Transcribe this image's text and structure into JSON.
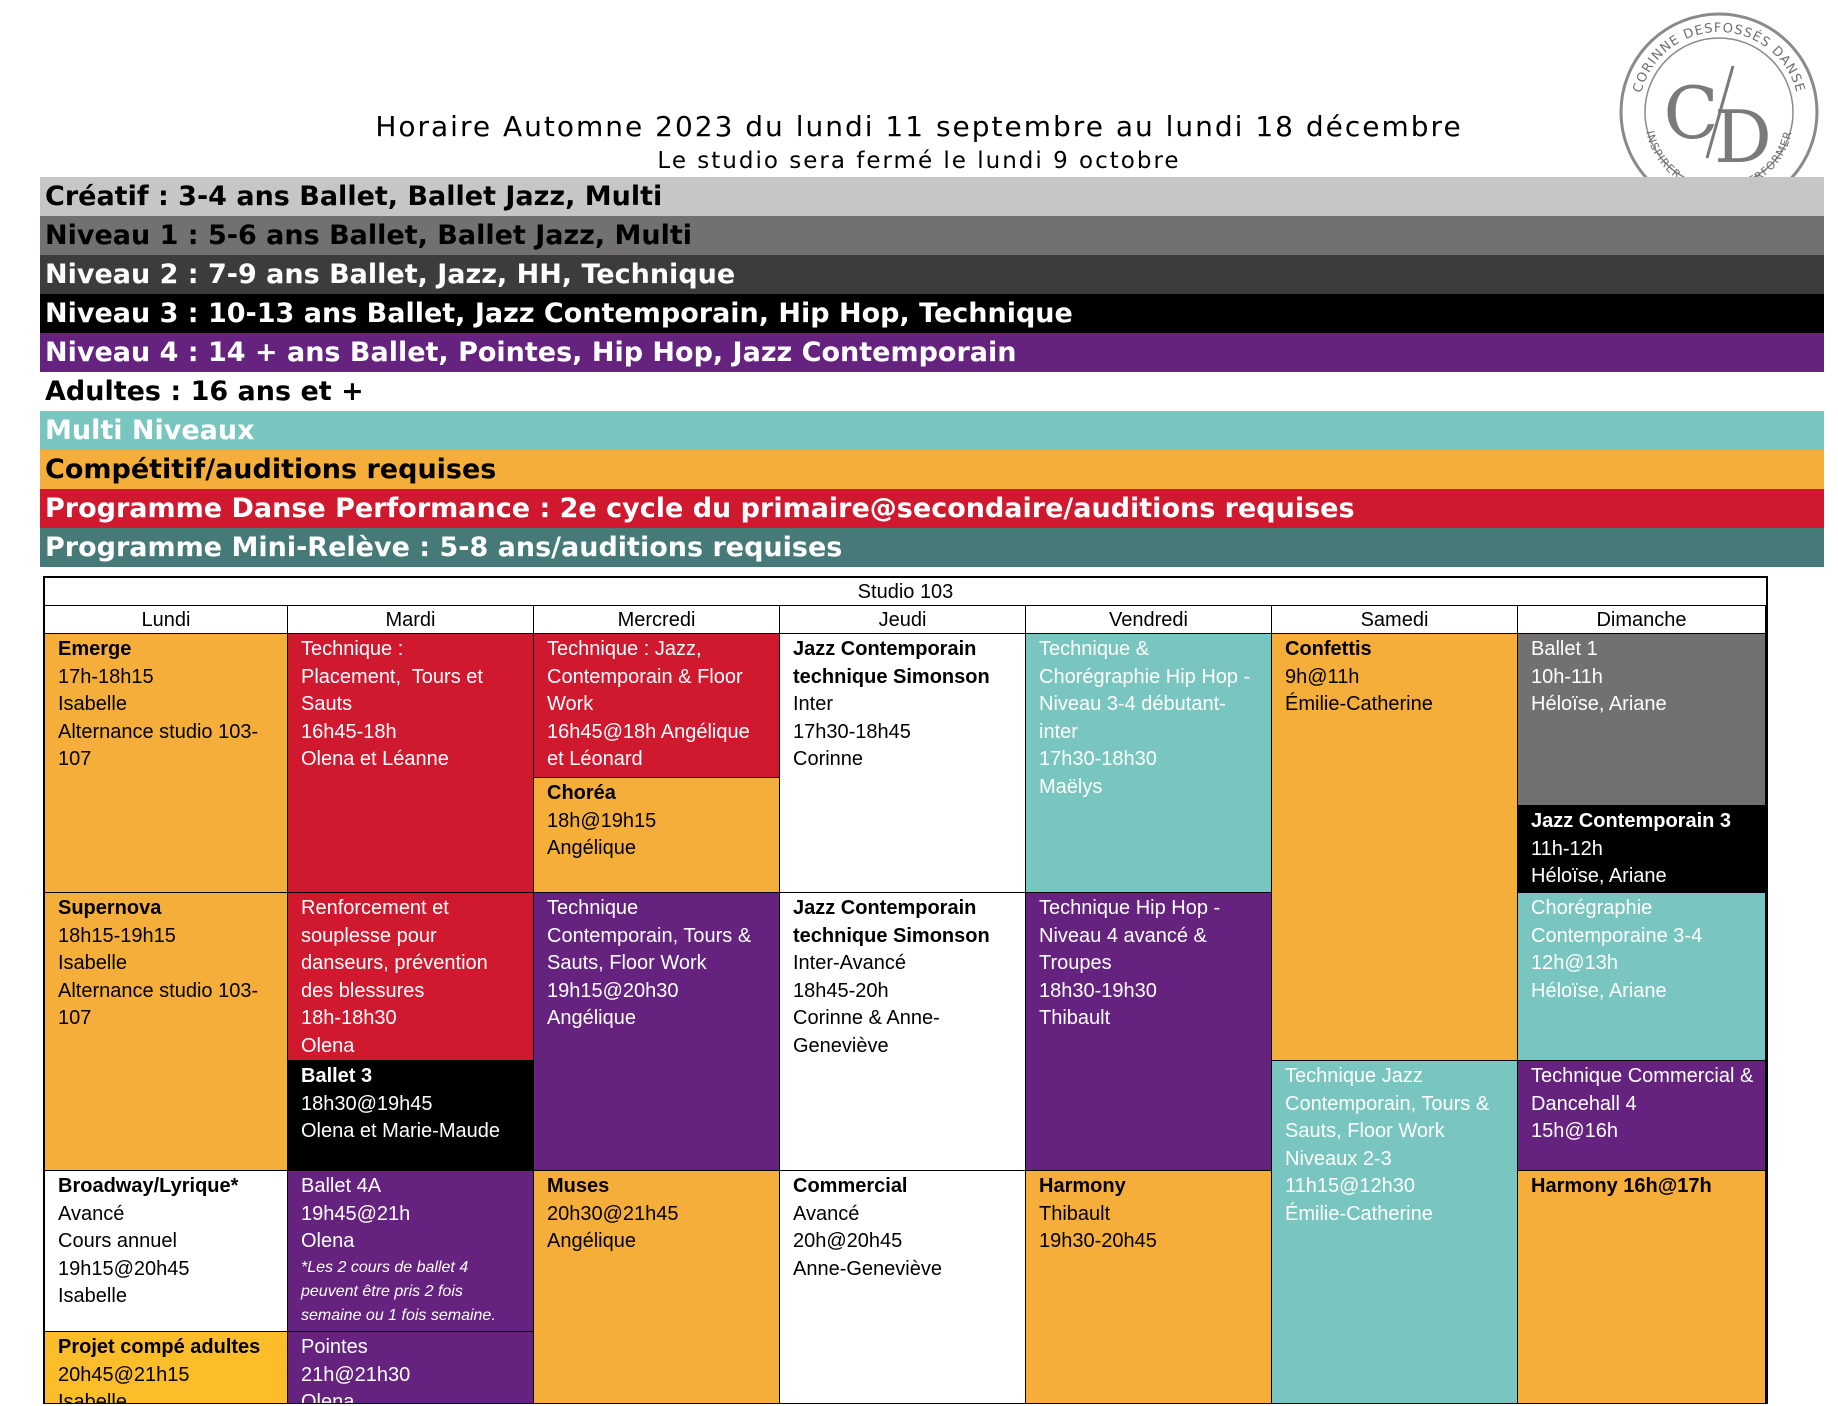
{
  "header": {
    "title": "Horaire Automne 2023 du lundi 11 septembre au lundi 18 décembre",
    "subtitle": "Le studio sera fermé le lundi 9 octobre"
  },
  "logo": {
    "monogram": "C/D",
    "ring_top": "CORINNE DESFOSSÉS DANSE",
    "ring_bottom": "INSPIRER · CRÉER · PERFORMER"
  },
  "legend": [
    {
      "label": "Créatif : 3-4 ans Ballet, Ballet Jazz, Multi",
      "bg": "#c6c6c6",
      "fg": "#000000"
    },
    {
      "label": "Niveau 1 : 5-6 ans Ballet, Ballet Jazz, Multi",
      "bg": "#727070",
      "fg": "#000000"
    },
    {
      "label": "Niveau 2 : 7-9 ans Ballet, Jazz, HH, Technique",
      "bg": "#3c3c3c",
      "fg": "#ffffff"
    },
    {
      "label": "Niveau 3 : 10-13 ans Ballet, Jazz Contemporain, Hip Hop, Technique",
      "bg": "#000000",
      "fg": "#ffffff"
    },
    {
      "label": "Niveau 4 : 14 + ans Ballet, Pointes, Hip Hop, Jazz Contemporain",
      "bg": "#65237f",
      "fg": "#ffffff"
    },
    {
      "label": "Adultes : 16 ans et +",
      "bg": "#ffffff",
      "fg": "#000000"
    },
    {
      "label": "Multi Niveaux",
      "bg": "#78c6bf",
      "fg": "#ffffff"
    },
    {
      "label": "Compétitif/auditions requises",
      "bg": "#f6ae3a",
      "fg": "#000000"
    },
    {
      "label": "Programme Danse Performance : 2e cycle du primaire@secondaire/auditions requises",
      "bg": "#d0182f",
      "fg": "#ffffff"
    },
    {
      "label": "Programme Mini-Relève : 5-8 ans/auditions requises",
      "bg": "#467a78",
      "fg": "#ffffff"
    }
  ],
  "schedule": {
    "studio": "Studio 103",
    "days": [
      "Lundi",
      "Mardi",
      "Mercredi",
      "Jeudi",
      "Vendredi",
      "Samedi",
      "Dimanche"
    ],
    "classes": {
      "lundi": [
        {
          "lines": [
            "Emerge",
            "17h-18h15",
            "Isabelle",
            "Alternance studio 103-107"
          ],
          "color": "orange"
        },
        {
          "lines": [
            "Supernova",
            "18h15-19h15",
            "Isabelle",
            "Alternance studio 103-107"
          ],
          "color": "orange"
        },
        {
          "lines": [
            "Broadway/Lyrique*",
            "Avancé",
            "Cours annuel",
            "19h15@20h45",
            "Isabelle"
          ],
          "color": "white"
        },
        {
          "lines": [
            "Projet compé adultes",
            "20h45@21h15",
            "Isabelle"
          ],
          "color": "yellow"
        }
      ],
      "mardi": [
        {
          "lines": [
            "Technique :",
            "Placement,  Tours et Sauts",
            "16h45-18h",
            "Olena et Léanne"
          ],
          "color": "red"
        },
        {
          "lines": [
            "Renforcement et souplesse pour danseurs, prévention des blessures",
            "18h-18h30",
            "Olena"
          ],
          "color": "red"
        },
        {
          "lines": [
            "Ballet 3",
            "18h30@19h45",
            "Olena et Marie-Maude"
          ],
          "color": "black"
        },
        {
          "lines": [
            "Ballet 4A",
            "19h45@21h",
            "Olena"
          ],
          "note": "*Les 2 cours de ballet 4 peuvent être pris 2 fois semaine ou 1 fois semaine.",
          "color": "purple"
        },
        {
          "lines": [
            "Pointes",
            "21h@21h30",
            "Olena"
          ],
          "color": "purple"
        }
      ],
      "mercredi": [
        {
          "lines": [
            "Technique : Jazz, Contemporain & Floor Work",
            "16h45@18h Angélique et Léonard"
          ],
          "color": "red"
        },
        {
          "lines": [
            "Choréa",
            "18h@19h15",
            "Angélique"
          ],
          "color": "orange"
        },
        {
          "lines": [
            "Technique",
            "Contemporain, Tours & Sauts, Floor Work",
            "19h15@20h30",
            "Angélique"
          ],
          "color": "purple"
        },
        {
          "lines": [
            "Muses",
            "20h30@21h45",
            "Angélique"
          ],
          "color": "orange"
        }
      ],
      "jeudi": [
        {
          "lines": [
            "Jazz Contemporain technique Simonson",
            "Inter",
            "17h30-18h45",
            "Corinne"
          ],
          "color": "white"
        },
        {
          "lines": [
            "Jazz Contemporain technique Simonson",
            "Inter-Avancé",
            "18h45-20h",
            "Corinne & Anne-Geneviève"
          ],
          "color": "white"
        },
        {
          "lines": [
            "Commercial",
            "Avancé",
            "20h@20h45",
            "Anne-Geneviève"
          ],
          "color": "white"
        }
      ],
      "vendredi": [
        {
          "lines": [
            "Technique & Chorégraphie Hip Hop - Niveau 3-4 débutant-inter",
            "17h30-18h30",
            "Maëlys"
          ],
          "color": "teal"
        },
        {
          "lines": [
            "Technique Hip Hop - Niveau 4 avancé & Troupes",
            "18h30-19h30",
            "Thibault"
          ],
          "color": "purple"
        },
        {
          "lines": [
            "Harmony",
            "Thibault",
            "19h30-20h45"
          ],
          "color": "orange"
        }
      ],
      "samedi": [
        {
          "lines": [
            "Confettis",
            "9h@11h",
            "Émilie-Catherine"
          ],
          "color": "orange"
        },
        {
          "lines": [
            "Technique Jazz Contemporain, Tours & Sauts, Floor Work",
            "Niveaux 2-3",
            "11h15@12h30",
            "Émilie-Catherine"
          ],
          "color": "teal"
        }
      ],
      "dimanche": [
        {
          "lines": [
            "Ballet 1",
            "10h-11h",
            "Héloïse, Ariane"
          ],
          "color": "gray"
        },
        {
          "lines": [
            "Jazz Contemporain 3",
            "11h-12h",
            "Héloïse, Ariane"
          ],
          "color": "black"
        },
        {
          "lines": [
            "Chorégraphie",
            "Contemporaine 3-4",
            "12h@13h",
            "Héloïse, Ariane"
          ],
          "color": "teal"
        },
        {
          "lines": [
            "Technique Commercial & Dancehall 4",
            "15h@16h"
          ],
          "color": "purple"
        },
        {
          "lines": [
            "Harmony 16h@17h"
          ],
          "color": "orange"
        }
      ]
    }
  }
}
